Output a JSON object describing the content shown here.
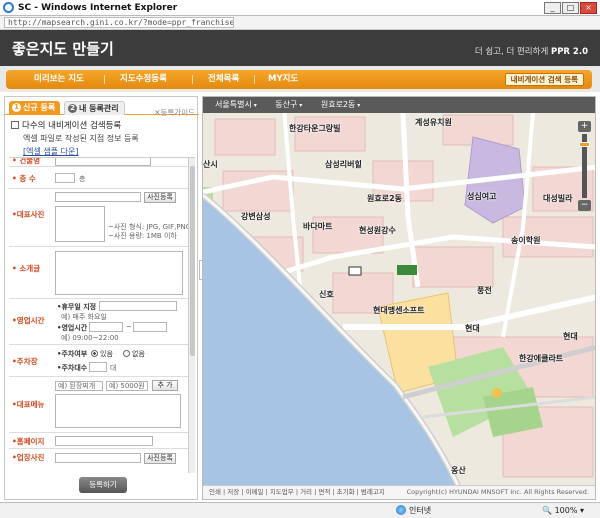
{
  "window": {
    "title": "SC - Windows Internet Explorer",
    "url": "http://mapsearch.gini.co.kr/?mode=ppr_franchise_regist",
    "controls": [
      "_",
      "□",
      "×"
    ]
  },
  "header": {
    "logo": "좋은지도 만들기",
    "tagline": "더 쉽고, 더 편리하게 ",
    "version": "PPR 2.0"
  },
  "nav": {
    "items": [
      "미리보는 지도",
      "지도수정등록",
      "전체목록",
      "MY지도"
    ],
    "button": "내비게이션 검색 등록"
  },
  "panel": {
    "tabs": [
      "신규 등록",
      "내 등록관리"
    ],
    "tab_badges": [
      "1",
      "2"
    ],
    "guide": "등록가이드",
    "bulk_title": "다수의 내비게이션 검색등록",
    "bulk_desc": "엑셀 파일로 작성된 지점 정보 등록",
    "bulk_link": "[엑셀 샘플 다운]",
    "submit": "등록하기",
    "collapse": "‹"
  },
  "form": {
    "building": "• 건물명",
    "floor": "• 층 수",
    "floor_unit": "층",
    "photo": "•대표사진",
    "photo_btn": "사진등록",
    "photo_note1": "~사진 형식: JPG, GIF,PNG",
    "photo_note2": "~사진 용량: 1MB 이하",
    "intro": "• 소개글",
    "hours": "•영업시간",
    "holiday_label": "•휴무일 지정",
    "holiday_example": "예) 매주 화요일",
    "hours_label": "•영업시간",
    "hours_tilde": "~",
    "hours_example": "예) 09:00~22:00",
    "parking": "•주차장",
    "parking_label": "•주차여부",
    "parking_yes": "있음",
    "parking_no": "없음",
    "parking_count_label": "•주차대수",
    "parking_unit": "대",
    "menu": "•대표메뉴",
    "menu_name_ph": "예) 된장찌개",
    "menu_price_ph": "예) 5000원",
    "menu_add": "추 가",
    "homepage": "•홈페이지",
    "business_photo": "•업장사진",
    "business_photo_btn": "사진등록"
  },
  "map": {
    "breadcrumb": [
      "서울특별시",
      "동산구",
      "원효로2동"
    ],
    "labels": [
      "한강타운그랑빌",
      "계성유치원",
      "삼성리버힐",
      "성심여고",
      "대성빌라",
      "원효로2동",
      "강변삼성",
      "바다마트",
      "현성원강수",
      "송이학원",
      "신호",
      "풍전",
      "현대맹센소프트",
      "현대",
      "현대",
      "한강에클라트",
      "산시",
      "옹산"
    ],
    "zoom_in": "+",
    "zoom_out": "−",
    "footer_links": "인쇄 | 저장 | 이메일 | 지도업무 | 거리 | 면적 | 초기화 | 범례고지",
    "copyright": "Copyright(c) HYUNDAI MNSOFT Inc. All Rights Reserved."
  },
  "status": {
    "zone": "인터넷",
    "zoom": "100%"
  },
  "colors": {
    "accent": "#f39a1e",
    "header": "#3c3c3c",
    "water": "#a7c4e4",
    "park": "#b7dfa0",
    "road": "#ffffff",
    "block": "#f2d7d3"
  }
}
